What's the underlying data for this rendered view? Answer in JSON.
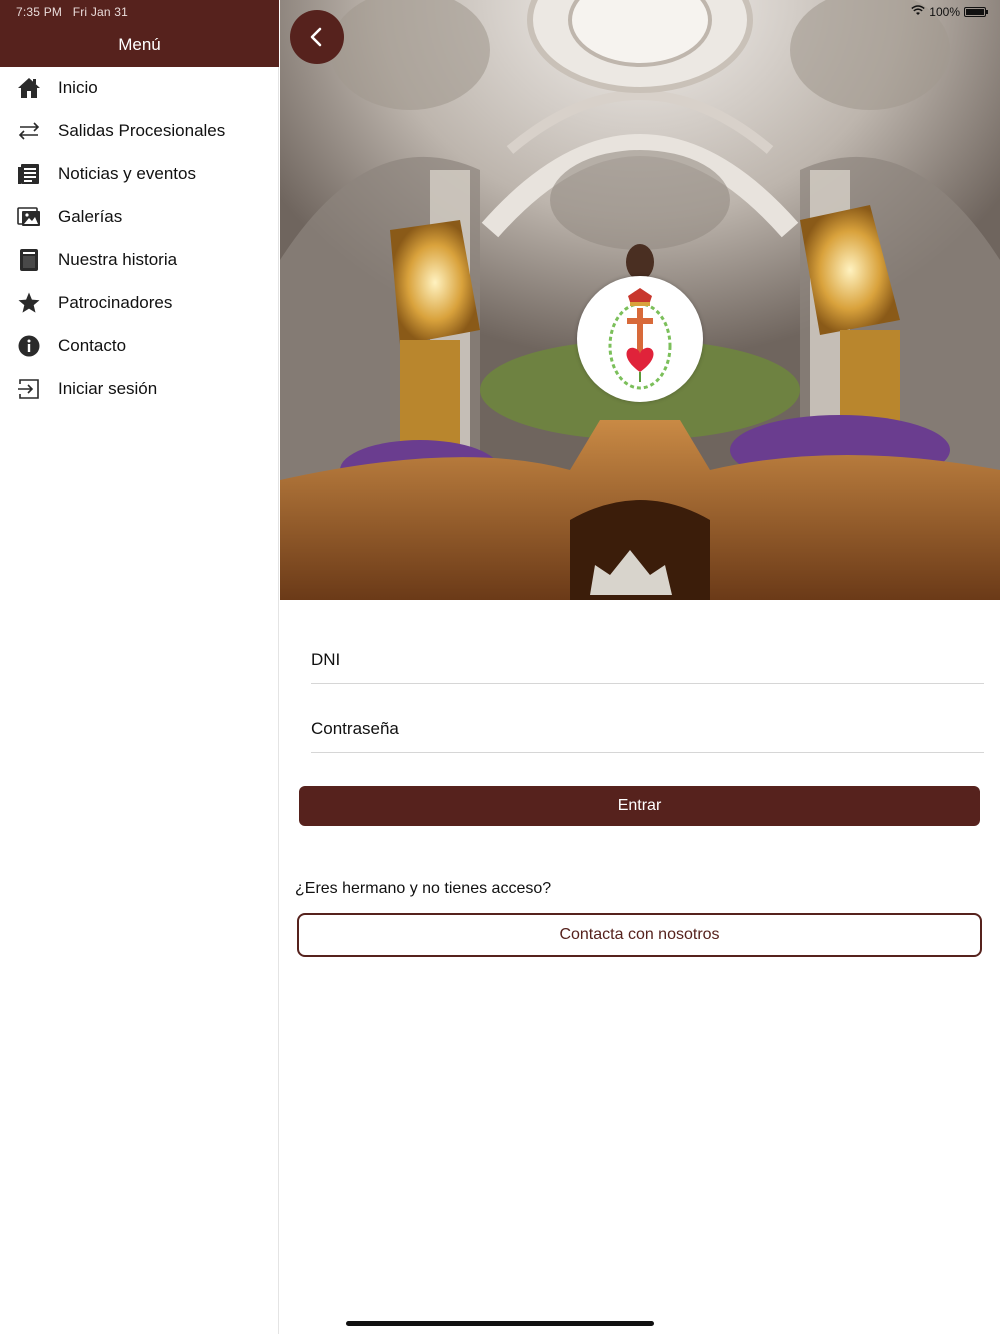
{
  "status_bar": {
    "time": "7:35 PM",
    "date": "Fri Jan 31",
    "battery": "100%"
  },
  "sidebar": {
    "title": "Menú",
    "items": [
      {
        "label": "Inicio",
        "icon": "home-icon"
      },
      {
        "label": "Salidas Procesionales",
        "icon": "swap-arrows-icon"
      },
      {
        "label": "Noticias y eventos",
        "icon": "newspaper-icon"
      },
      {
        "label": "Galerías",
        "icon": "gallery-icon"
      },
      {
        "label": "Nuestra historia",
        "icon": "book-icon"
      },
      {
        "label": "Patrocinadores",
        "icon": "star-icon"
      },
      {
        "label": "Contacto",
        "icon": "info-icon"
      },
      {
        "label": "Iniciar sesión",
        "icon": "login-icon"
      }
    ]
  },
  "login": {
    "dni_placeholder": "DNI",
    "password_placeholder": "Contraseña",
    "submit_label": "Entrar",
    "question": "¿Eres hermano y no tienes acceso?",
    "contact_label": "Contacta con nosotros"
  },
  "colors": {
    "brand": "#56221d",
    "background": "#ffffff"
  }
}
